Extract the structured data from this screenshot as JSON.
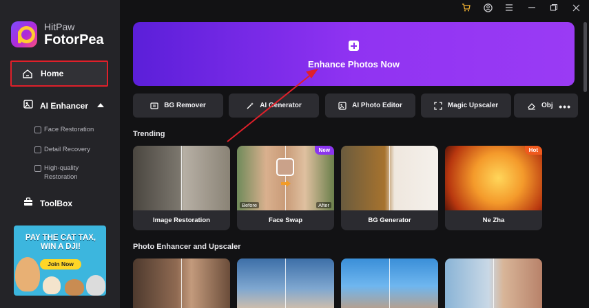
{
  "app": {
    "brand": "HitPaw",
    "product": "FotorPea"
  },
  "sidebar": {
    "home": "Home",
    "ai_enhancer": "AI Enhancer",
    "sub_items": [
      "Face Restoration",
      "Detail Recovery",
      "High-quality Restoration"
    ],
    "toolbox": "ToolBox",
    "ad": {
      "headline": "PAY THE CAT TAX, WIN A DJI!",
      "button": "Join Now"
    }
  },
  "titlebar": {
    "icons": [
      "cart-icon",
      "user-icon",
      "menu-icon",
      "minimize-icon",
      "maximize-icon",
      "close-icon"
    ]
  },
  "hero": {
    "label": "Enhance Photos Now"
  },
  "tools": [
    "BG Remover",
    "AI Generator",
    "AI Photo Editor",
    "Magic Upscaler",
    "Obj"
  ],
  "sections": {
    "trending": "Trending",
    "enhancer": "Photo Enhancer and Upscaler"
  },
  "trending": [
    {
      "title": "Image Restoration"
    },
    {
      "title": "Face Swap",
      "badge": "New",
      "before": "Before",
      "after": "After"
    },
    {
      "title": "BG Generator"
    },
    {
      "title": "Ne Zha",
      "badge": "Hot"
    }
  ],
  "colors": {
    "accent": "#8b35f0",
    "highlight_box": "#e0202a",
    "hot": "#ef5a1e"
  }
}
